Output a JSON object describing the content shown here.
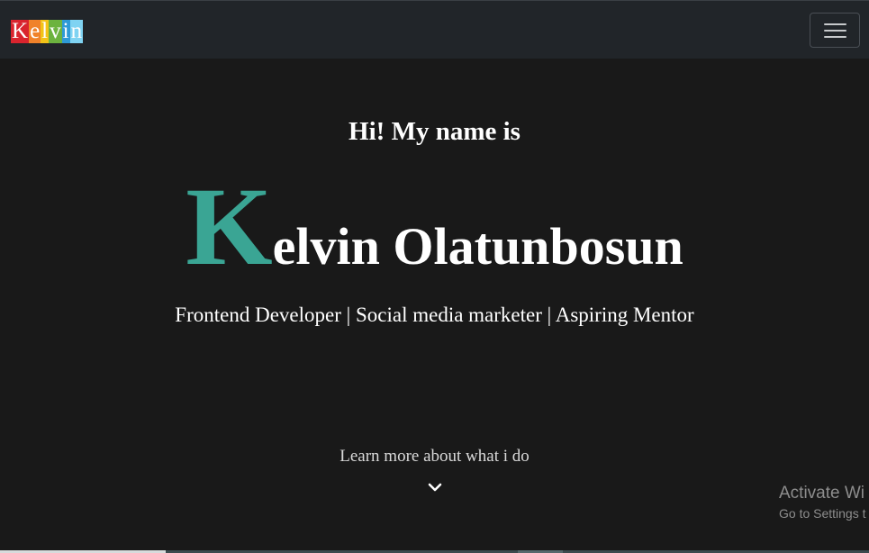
{
  "navbar": {
    "logo_letters": [
      "K",
      "e",
      "l",
      "v",
      "i",
      "n"
    ],
    "logo_colors": [
      "#d9242e",
      "#f0822a",
      "#f2c318",
      "#6cb33f",
      "#2e9ad6",
      "#7fd3f2"
    ],
    "toggler_icon": "hamburger-menu-icon"
  },
  "hero": {
    "greeting": "Hi! My name is",
    "name_initial": "K",
    "name_rest": "elvin Olatunbosun",
    "roles": "Frontend Developer | Social media marketer | Aspiring Mentor",
    "learn_more": "Learn more about what i do",
    "scroll_icon": "chevron-down-icon",
    "accent_color": "#3aa594"
  },
  "os_watermark": {
    "title": "Activate Wi",
    "subtitle": "Go to Settings t"
  }
}
